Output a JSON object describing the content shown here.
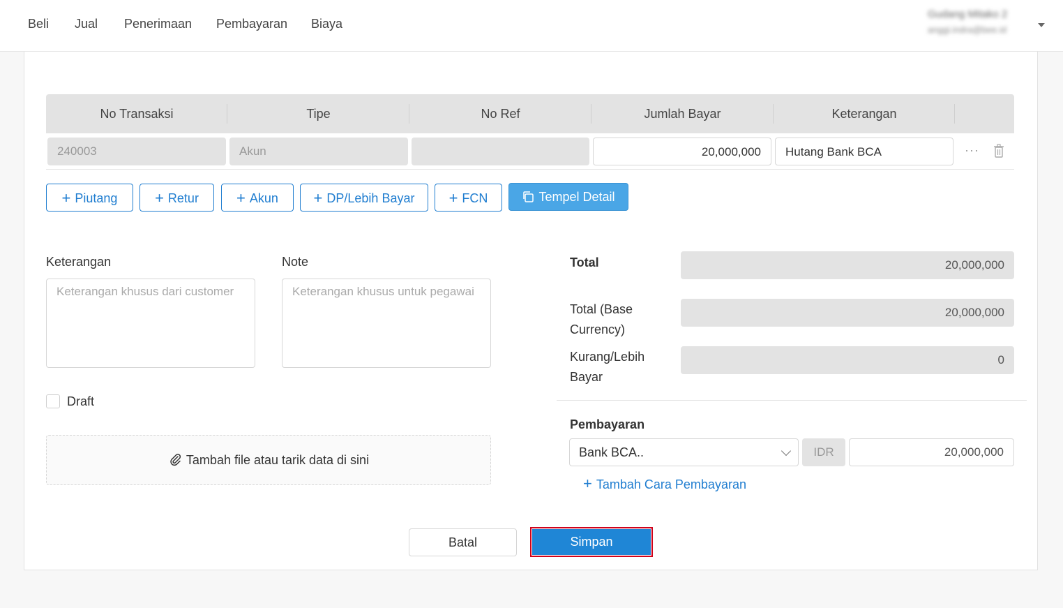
{
  "nav": {
    "items": [
      {
        "label": "Beli"
      },
      {
        "label": "Jual"
      },
      {
        "label": "Penerimaan"
      },
      {
        "label": "Pembayaran"
      },
      {
        "label": "Biaya"
      }
    ]
  },
  "user": {
    "name": "Gudang Mitako 2",
    "email": "anggi.indra@bee.id",
    "dropdown_icon": "caret-down-icon"
  },
  "table": {
    "columns": [
      "No Transaksi",
      "Tipe",
      "No Ref",
      "Jumlah Bayar",
      "Keterangan"
    ],
    "row": {
      "no_transaksi": "240003",
      "tipe": "Akun",
      "no_ref": "",
      "jumlah_bayar": "20,000,000",
      "keterangan": "Hutang Bank BCA"
    },
    "row_actions": [
      "more-icon",
      "trash-icon"
    ]
  },
  "add_buttons": {
    "piutang": "Piutang",
    "retur": "Retur",
    "akun": "Akun",
    "dp": "DP/Lebih Bayar",
    "fcn": "FCN",
    "paste": "Tempel Detail"
  },
  "form": {
    "keterangan_label": "Keterangan",
    "keterangan_placeholder": "Keterangan khusus dari customer",
    "note_label": "Note",
    "note_placeholder": "Keterangan khusus untuk pegawai",
    "draft_label": "Draft",
    "draft_checked": false,
    "upload_text": "Tambah file atau tarik data di sini"
  },
  "summary": {
    "total_label": "Total",
    "total_value": "20,000,000",
    "total_base_label": "Total (Base Currency)",
    "total_base_value": "20,000,000",
    "kurang_label": "Kurang/Lebih Bayar",
    "kurang_value": "0"
  },
  "payment": {
    "label": "Pembayaran",
    "method": "Bank BCA..",
    "currency": "IDR",
    "amount": "20,000,000",
    "add_label": "Tambah Cara Pembayaran"
  },
  "actions": {
    "cancel": "Batal",
    "save": "Simpan"
  },
  "colors": {
    "accent": "#1f86d6",
    "highlight": "#d0021b",
    "paste_button": "#4aa6e6"
  }
}
